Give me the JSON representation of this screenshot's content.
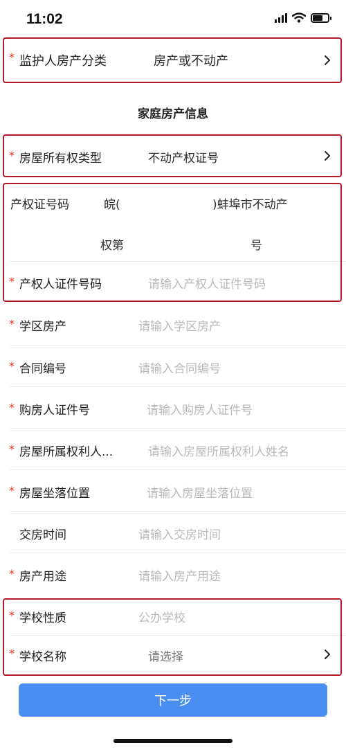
{
  "status_bar": {
    "time": "11:02"
  },
  "guardian_property": {
    "label": "监护人房产分类",
    "value": "房产或不动产"
  },
  "section_title": "家庭房产信息",
  "ownership_type": {
    "label": "房屋所有权类型",
    "value": "不动产权证号"
  },
  "certificate": {
    "label": "产权证号码",
    "prefix": "皖(",
    "middle": ")蚌埠市不动产",
    "line2_left": "权第",
    "line2_right": "号"
  },
  "owner_id": {
    "label": "产权人证件号码",
    "placeholder": "请输入产权人证件号码"
  },
  "fields": [
    {
      "label": "学区房产",
      "placeholder": "请输入学区房产",
      "required": true
    },
    {
      "label": "合同编号",
      "placeholder": "请输入合同编号",
      "required": true
    },
    {
      "label": "购房人证件号",
      "placeholder": "请输入购房人证件号",
      "required": true
    },
    {
      "label": "房屋所属权利人...",
      "placeholder": "请输入房屋所属权利人姓名",
      "required": true
    },
    {
      "label": "房屋坐落位置",
      "placeholder": "请输入房屋坐落位置",
      "required": true
    },
    {
      "label": "交房时间",
      "placeholder": "请输入交房时间",
      "required": false
    },
    {
      "label": "房产用途",
      "placeholder": "请输入房产用途",
      "required": true
    }
  ],
  "school_type": {
    "label": "学校性质",
    "placeholder": "公办学校"
  },
  "school_name": {
    "label": "学校名称",
    "placeholder": "请选择"
  },
  "next_button": "下一步",
  "required_mark": "*",
  "colors": {
    "accent": "#4a8ef0",
    "required": "#e0301e",
    "highlight_box": "#b3192a",
    "placeholder": "#b9b9b9"
  }
}
